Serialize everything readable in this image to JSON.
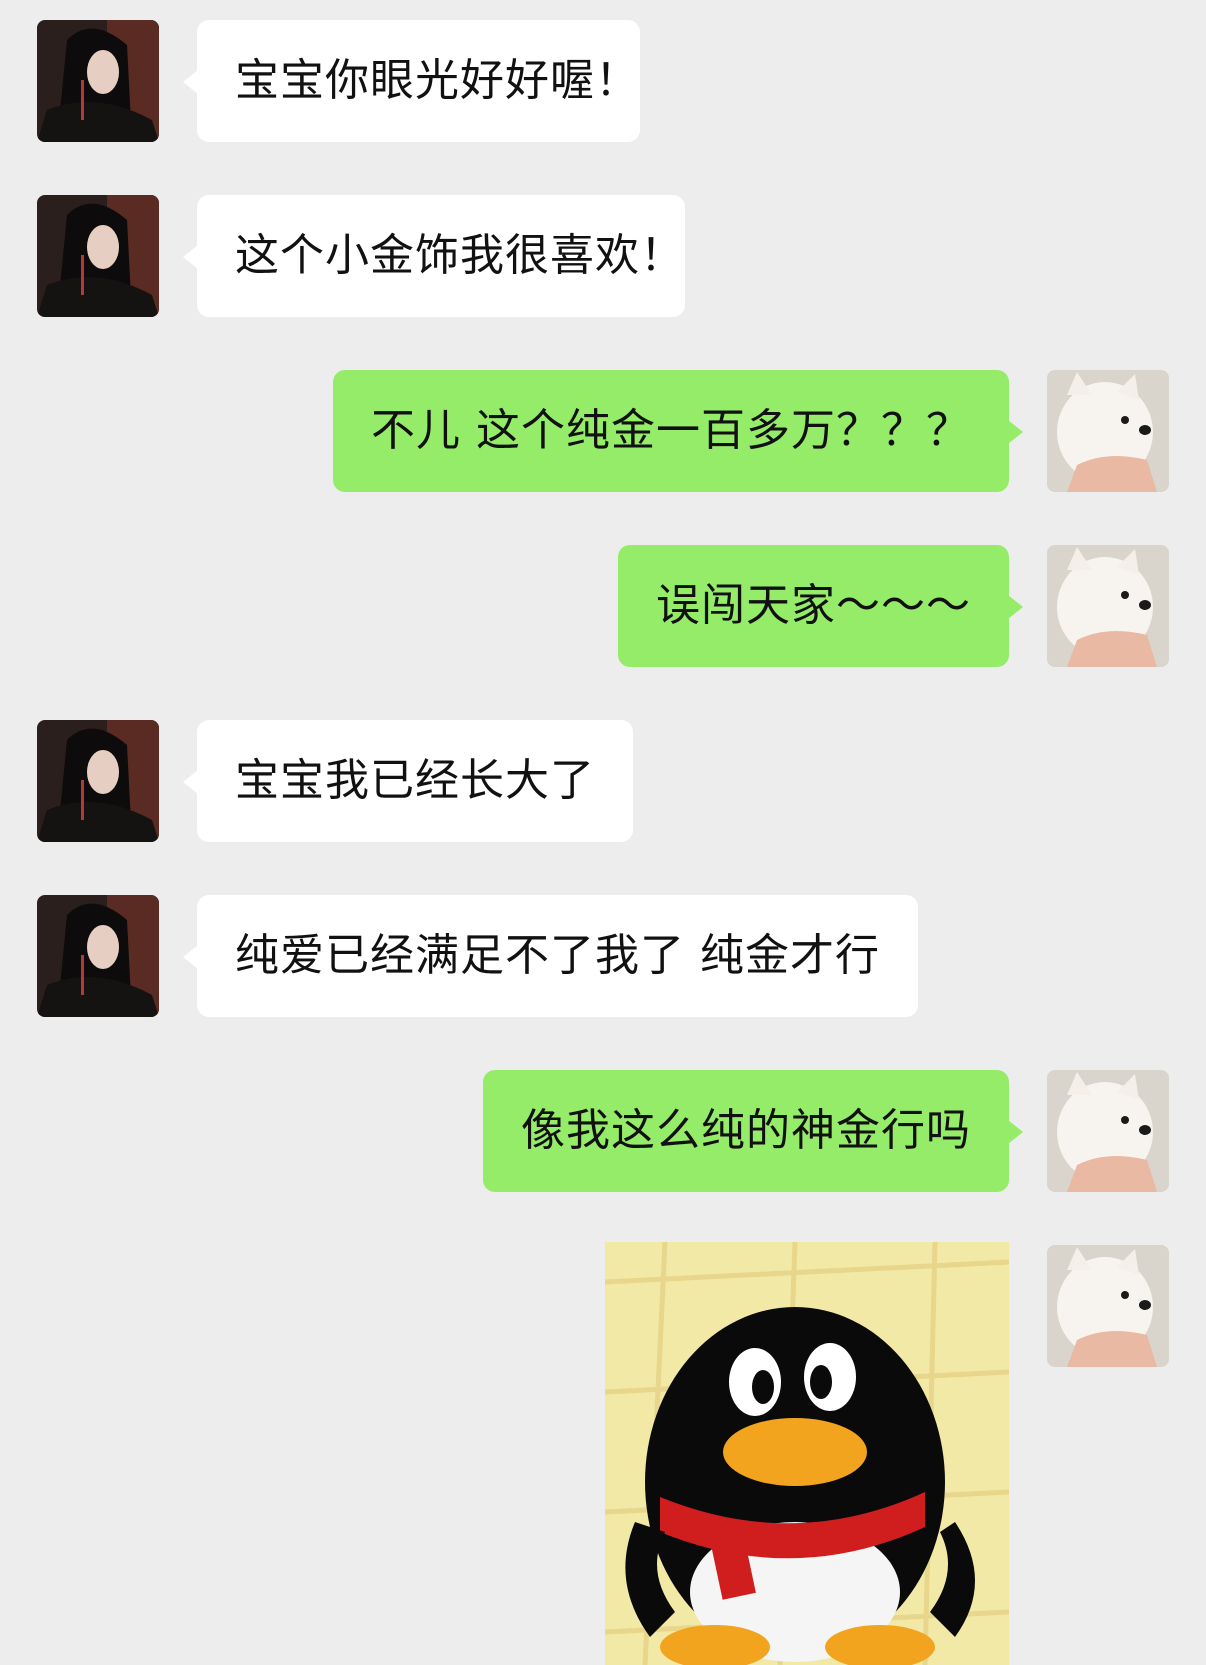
{
  "messages": [
    {
      "sender": "friend",
      "text": "宝宝你眼光好好喔！"
    },
    {
      "sender": "friend",
      "text": "这个小金饰我很喜欢！"
    },
    {
      "sender": "me",
      "text": "不儿 这个纯金一百多万？？？"
    },
    {
      "sender": "me",
      "text": "误闯天家～～～"
    },
    {
      "sender": "friend",
      "text": "宝宝我已经长大了"
    },
    {
      "sender": "friend",
      "text": "纯爱已经满足不了我了 纯金才行"
    },
    {
      "sender": "me",
      "text": "像我这么纯的神金行吗"
    },
    {
      "sender": "me",
      "type": "sticker",
      "sticker": "qq-penguin-sticker"
    }
  ],
  "avatars": {
    "friend": "woman-dark-portrait-avatar",
    "me": "white-dog-avatar"
  },
  "colors": {
    "background": "#ededed",
    "incoming_bubble": "#ffffff",
    "outgoing_bubble": "#95ec69",
    "text": "#111111"
  }
}
